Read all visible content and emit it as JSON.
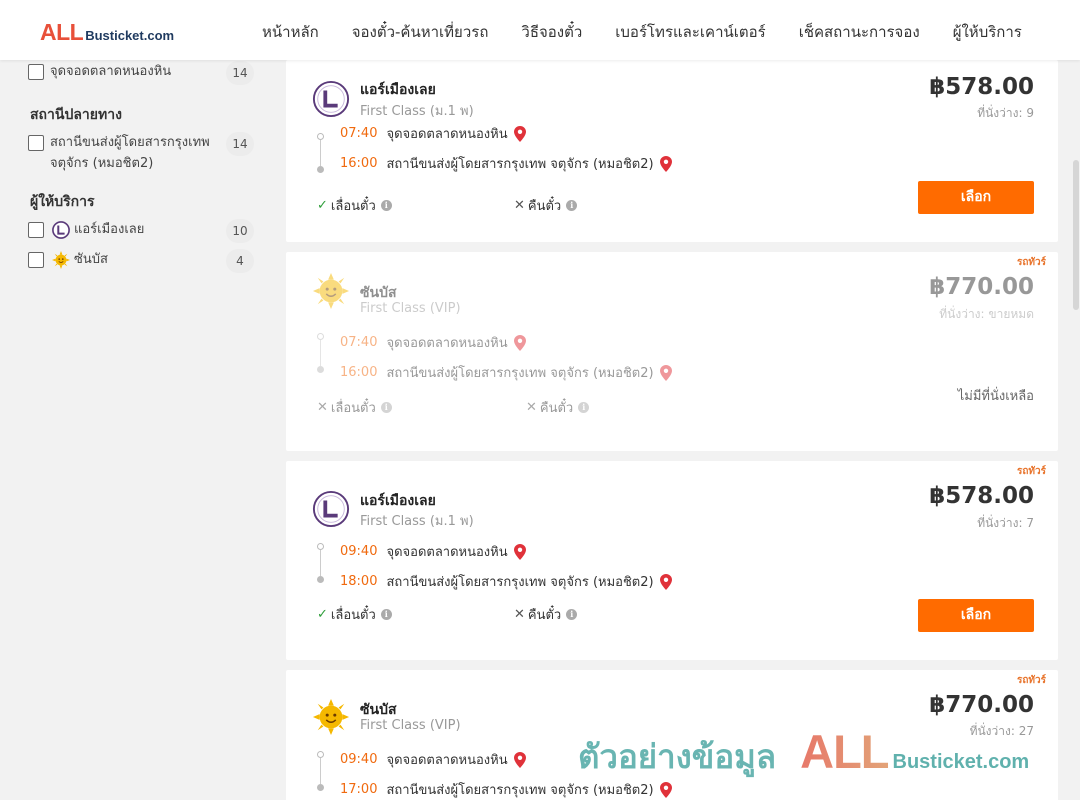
{
  "brand": {
    "all": "ALL",
    "bus": "Busticket.com"
  },
  "nav": [
    "หน้าหลัก",
    "จองตั๋ว-ค้นหาเที่ยวรถ",
    "วิธีจองตั๋ว",
    "เบอร์โทรและเคาน์เตอร์",
    "เช็คสถานะการจอง",
    "ผู้ให้บริการ"
  ],
  "filters": {
    "origin_item": {
      "label": "จุดจอดตลาดหนองหิน",
      "count": "14"
    },
    "destination_heading": "สถานีปลายทาง",
    "destination_item": {
      "label": "สถานีขนส่งผู้โดยสารกรุงเทพ จตุจักร (หมอชิต2)",
      "count": "14"
    },
    "operator_heading": "ผู้ให้บริการ",
    "operators": [
      {
        "label": "แอร์เมืองเลย",
        "count": "10",
        "icon": "air-muang-loei-logo-icon"
      },
      {
        "label": "ซันบัส",
        "count": "4",
        "icon": "sun-icon"
      }
    ]
  },
  "trips": [
    {
      "operator": "แอร์เมืองเลย",
      "class": "First Class (ม.1 พ)",
      "price": "฿578.00",
      "seats": "ที่นั่งว่าง: 9",
      "tag": "",
      "dep_time": "07:40",
      "dep_stop": "จุดจอดตลาดหนองหิน",
      "arr_time": "16:00",
      "arr_stop": "สถานีขนส่งผู้โดยสารกรุงเทพ จตุจักร (หมอชิต2)",
      "reschedule": "เลื่อนตั๋ว",
      "refund": "คืนตั๋ว",
      "select": "เลือก"
    },
    {
      "operator": "ซันบัส",
      "class": "First Class (VIP)",
      "price": "฿770.00",
      "seats": "ที่นั่งว่าง: ขายหมด",
      "tag": "รถทัวร์",
      "dep_time": "07:40",
      "dep_stop": "จุดจอดตลาดหนองหิน",
      "arr_time": "16:00",
      "arr_stop": "สถานีขนส่งผู้โดยสารกรุงเทพ จตุจักร (หมอชิต2)",
      "reschedule": "เลื่อนตั๋ว",
      "refund": "คืนตั๋ว",
      "soldout": "ไม่มีที่นั่งเหลือ"
    },
    {
      "operator": "แอร์เมืองเลย",
      "class": "First Class (ม.1 พ)",
      "price": "฿578.00",
      "seats": "ที่นั่งว่าง: 7",
      "tag": "รถทัวร์",
      "dep_time": "09:40",
      "dep_stop": "จุดจอดตลาดหนองหิน",
      "arr_time": "18:00",
      "arr_stop": "สถานีขนส่งผู้โดยสารกรุงเทพ จตุจักร (หมอชิต2)",
      "reschedule": "เลื่อนตั๋ว",
      "refund": "คืนตั๋ว",
      "select": "เลือก"
    },
    {
      "operator": "ซันบัส",
      "class": "First Class (VIP)",
      "price": "฿770.00",
      "seats": "ที่นั่งว่าง: 27",
      "tag": "รถทัวร์",
      "dep_time": "09:40",
      "dep_stop": "จุดจอดตลาดหนองหิน",
      "arr_time": "17:00",
      "arr_stop": "สถานีขนส่งผู้โดยสารกรุงเทพ จตุจักร (หมอชิต2)"
    }
  ],
  "watermark": {
    "thai": "ตัวอย่างข้อมูล",
    "all": "ALL",
    "bus": "Busticket.com"
  },
  "colors": {
    "accent": "#ff6b00",
    "time": "#f06a0f",
    "brand_red": "#e8503a",
    "brand_blue": "#1f3a5f",
    "pin": "#e0323a",
    "check": "#2e9e3a"
  }
}
